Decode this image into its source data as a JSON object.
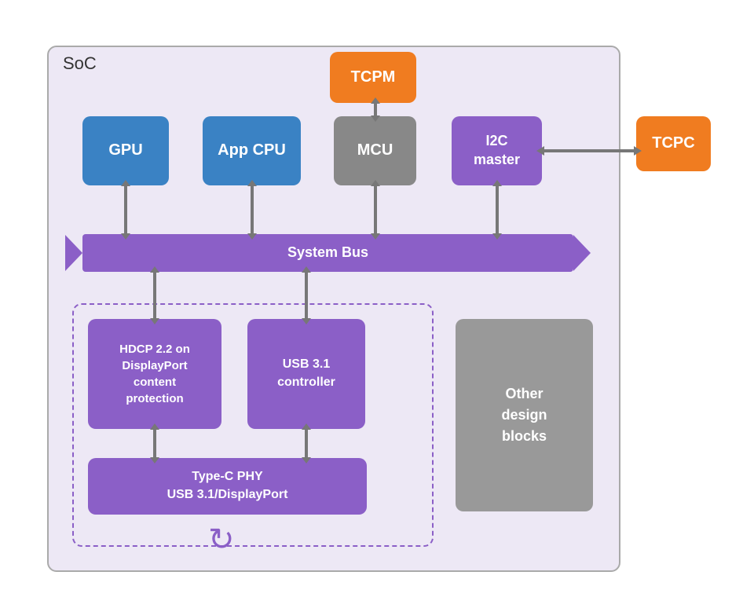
{
  "diagram": {
    "soc_label": "SoC",
    "blocks": {
      "gpu": "GPU",
      "app_cpu": "App CPU",
      "mcu": "MCU",
      "i2c": "I2C\nmaster",
      "tcpm": "TCPM",
      "tcpc": "TCPC",
      "system_bus": "System Bus",
      "hdcp": "HDCP 2.2 on\nDisplayPort\ncontent\nprotection",
      "usb_ctrl": "USB 3.1\ncontroller",
      "type_phy": "Type-C PHY\nUSB 3.1/DisplayPort",
      "other_blocks": "Other\ndesign\nblocks"
    }
  }
}
